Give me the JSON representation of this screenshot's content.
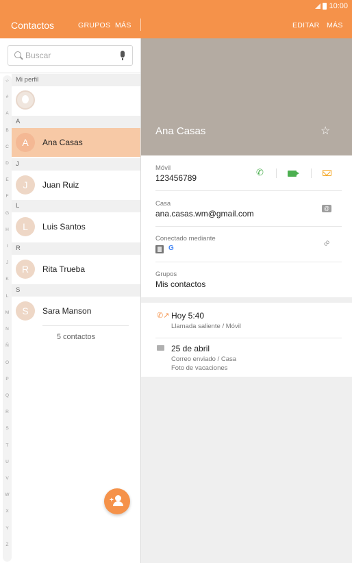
{
  "status": {
    "time": "10:00"
  },
  "header": {
    "title": "Contactos",
    "tab_groups": "GRUPOS",
    "tab_more": "MÁS",
    "edit_label": "EDITAR",
    "more_label": "MÁS"
  },
  "search": {
    "placeholder": "Buscar"
  },
  "index_letters": [
    "☆",
    "#",
    "A",
    "B",
    "C",
    "D",
    "E",
    "F",
    "G",
    "H",
    "I",
    "J",
    "K",
    "L",
    "M",
    "N",
    "Ñ",
    "O",
    "P",
    "Q",
    "R",
    "S",
    "T",
    "U",
    "V",
    "W",
    "X",
    "Y",
    "Z"
  ],
  "list": {
    "profile_header": "Mi perfil",
    "sections": [
      {
        "letter": "A",
        "contacts": [
          {
            "initial": "A",
            "name": "Ana Casas",
            "selected": true
          }
        ]
      },
      {
        "letter": "J",
        "contacts": [
          {
            "initial": "J",
            "name": "Juan Ruiz"
          }
        ]
      },
      {
        "letter": "L",
        "contacts": [
          {
            "initial": "L",
            "name": "Luis Santos"
          }
        ]
      },
      {
        "letter": "R",
        "contacts": [
          {
            "initial": "R",
            "name": "Rita Trueba"
          }
        ]
      },
      {
        "letter": "S",
        "contacts": [
          {
            "initial": "S",
            "name": "Sara Manson"
          }
        ]
      }
    ],
    "count_label": "5 contactos"
  },
  "detail": {
    "name": "Ana Casas",
    "mobile_label": "Móvil",
    "mobile_value": "123456789",
    "home_label": "Casa",
    "home_value": "ana.casas.wm@gmail.com",
    "linked_label": "Conectado mediante",
    "google_badge": "G",
    "groups_label": "Grupos",
    "groups_value": "Mis contactos"
  },
  "log": [
    {
      "title": "Hoy 5:40",
      "lines": [
        "Llamada saliente / Móvil"
      ]
    },
    {
      "title": "25 de abril",
      "lines": [
        "Correo enviado / Casa",
        "Foto de vacaciones"
      ]
    }
  ],
  "colors": {
    "accent": "#f5924a",
    "selected_row": "#f7c9a6",
    "hero": "#b4aba2"
  }
}
